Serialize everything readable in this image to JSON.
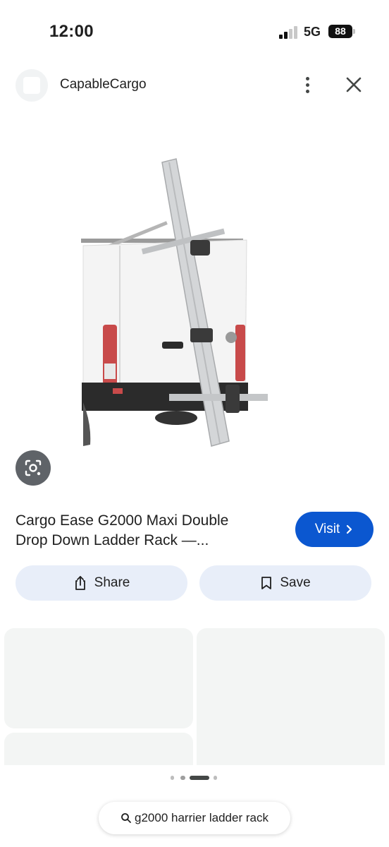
{
  "status_bar": {
    "time": "12:00",
    "network": "5G",
    "battery": "88"
  },
  "header": {
    "site_name": "CapableCargo",
    "more_icon": "more-vert-icon",
    "close_icon": "close-icon"
  },
  "result": {
    "title_line1": "Cargo Ease G2000 Maxi Double",
    "title_line2": "Drop Down Ladder Rack —...",
    "visit_label": "Visit",
    "visit_color": "#0b57d0"
  },
  "actions": {
    "share_label": "Share",
    "save_label": "Save"
  },
  "search": {
    "query": "g2000 harrier ladder rack"
  }
}
